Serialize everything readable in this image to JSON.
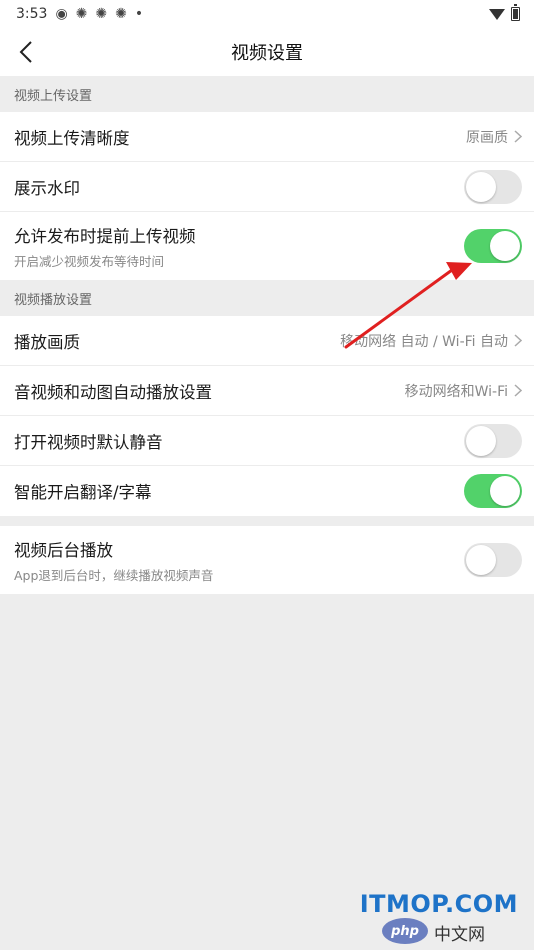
{
  "status_bar": {
    "time": "3:53",
    "icons": [
      "weibo-icon",
      "app-icon",
      "app-icon",
      "app-icon",
      "dot-icon"
    ],
    "dot": "•"
  },
  "header": {
    "title": "视频设置"
  },
  "sections": {
    "upload": {
      "header": "视频上传设置",
      "items": [
        {
          "title": "视频上传清晰度",
          "value": "原画质"
        },
        {
          "title": "展示水印",
          "toggle": false
        },
        {
          "title": "允许发布时提前上传视频",
          "subtitle": "开启减少视频发布等待时间",
          "toggle": true
        }
      ]
    },
    "playback": {
      "header": "视频播放设置",
      "items": [
        {
          "title": "播放画质",
          "value": "移动网络 自动 / Wi-Fi 自动"
        },
        {
          "title": "音视频和动图自动播放设置",
          "value": "移动网络和Wi-Fi"
        },
        {
          "title": "打开视频时默认静音",
          "toggle": false
        },
        {
          "title": "智能开启翻译/字幕",
          "toggle": true
        }
      ]
    },
    "background": {
      "items": [
        {
          "title": "视频后台播放",
          "subtitle": "App退到后台时，继续播放视频声音",
          "toggle": false
        }
      ]
    }
  },
  "colors": {
    "toggle_on": "#52d26a",
    "toggle_off": "#e5e5e5",
    "arrow": "#e02020",
    "watermark_blue": "#1e73c8"
  },
  "watermark": {
    "main": "ITMOP.COM",
    "logo": "php",
    "text": "中文网"
  }
}
